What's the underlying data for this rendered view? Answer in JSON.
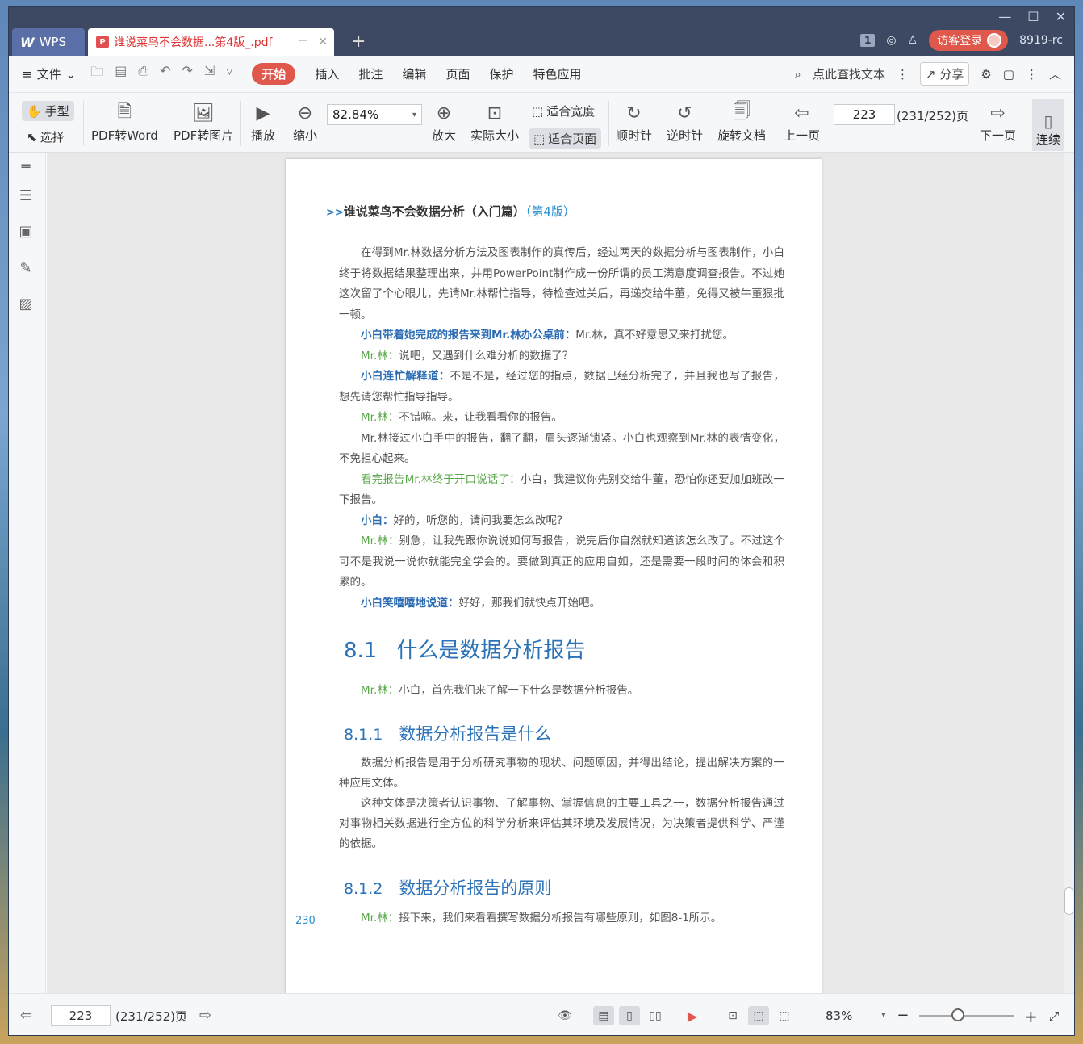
{
  "titlebar": {
    "app_name": "WPS",
    "doc_tab_title": "谁说菜鸟不会数据...第4版_.pdf",
    "new_tab_symbol": "+",
    "page_badge": "1",
    "login_label": "访客登录",
    "user_id": "8919-rc"
  },
  "menubar": {
    "file_label": "文件",
    "tabs": [
      "开始",
      "插入",
      "批注",
      "编辑",
      "页面",
      "保护",
      "特色应用"
    ],
    "active_tab": "开始",
    "search_label": "点此查找文本",
    "share_label": "分享"
  },
  "ribbon": {
    "hand_label": "手型",
    "select_label": "选择",
    "pdf_to_word": "PDF转Word",
    "pdf_to_image": "PDF转图片",
    "play": "播放",
    "zoom_out": "缩小",
    "zoom_value": "82.84%",
    "zoom_in": "放大",
    "actual_size": "实际大小",
    "fit_width": "适合宽度",
    "fit_page": "适合页面",
    "clockwise": "顺时针",
    "counterclockwise": "逆时针",
    "rotate_doc": "旋转文档",
    "prev_page": "上一页",
    "page_input": "223",
    "page_total": "(231/252)页",
    "next_page": "下一页",
    "continuous": "连续"
  },
  "document": {
    "header_arrow": ">>",
    "header_title": "谁说菜鸟不会数据分析（入门篇）",
    "header_edition": "（第4版）",
    "para1": "在得到Mr.林数据分析方法及图表制作的真传后，经过两天的数据分析与图表制作，小白终于将数据结果整理出来，并用PowerPoint制作成一份所谓的员工满意度调查报告。不过她这次留了个心眼儿，先请Mr.林帮忙指导，待检查过关后，再递交给牛董，免得又被牛董狠批一顿。",
    "d1_speaker": "小白带着她完成的报告来到Mr.林办公桌前：",
    "d1_text": "Mr.林，真不好意思又来打扰您。",
    "d2_speaker": "Mr.林：",
    "d2_text": "说吧，又遇到什么难分析的数据了？",
    "d3_speaker": "小白连忙解释道：",
    "d3_text": "不是不是，经过您的指点，数据已经分析完了，并且我也写了报告，想先请您帮忙指导指导。",
    "d4_speaker": "Mr.林：",
    "d4_text": "不错嘛。来，让我看看你的报告。",
    "para2": "Mr.林接过小白手中的报告，翻了翻，眉头逐渐锁紧。小白也观察到Mr.林的表情变化，不免担心起来。",
    "d5_speaker": "看完报告Mr.林终于开口说话了：",
    "d5_text": "小白，我建议你先别交给牛董，恐怕你还要加加班改一下报告。",
    "d6_speaker": "小白：",
    "d6_text": "好的，听您的，请问我要怎么改呢？",
    "d7_speaker": "Mr.林：",
    "d7_text": "别急，让我先跟你说说如何写报告，说完后你自然就知道该怎么改了。不过这个可不是我说一说你就能完全学会的。要做到真正的应用自如，还是需要一段时间的体会和积累的。",
    "d8_speaker": "小白笑嘻嘻地说道：",
    "d8_text": "好好，那我们就快点开始吧。",
    "h1_num": "8.1",
    "h1_title": "什么是数据分析报告",
    "d9_speaker": "Mr.林：",
    "d9_text": "小白，首先我们来了解一下什么是数据分析报告。",
    "h2_num": "8.1.1",
    "h2_title": "数据分析报告是什么",
    "para3": "数据分析报告是用于分析研究事物的现状、问题原因，并得出结论，提出解决方案的一种应用文体。",
    "para4": "这种文体是决策者认识事物、了解事物、掌握信息的主要工具之一，数据分析报告通过对事物相关数据进行全方位的科学分析来评估其环境及发展情况，为决策者提供科学、严谨的依据。",
    "h3_num": "8.1.2",
    "h3_title": "数据分析报告的原则",
    "d10_speaker": "Mr.林：",
    "d10_text": "接下来，我们来看看撰写数据分析报告有哪些原则，如图8-1所示。",
    "page_number": "230"
  },
  "statusbar": {
    "page_input": "223",
    "page_total": "(231/252)页",
    "zoom_percent": "83%",
    "zoom_minus": "−",
    "zoom_plus": "+"
  }
}
